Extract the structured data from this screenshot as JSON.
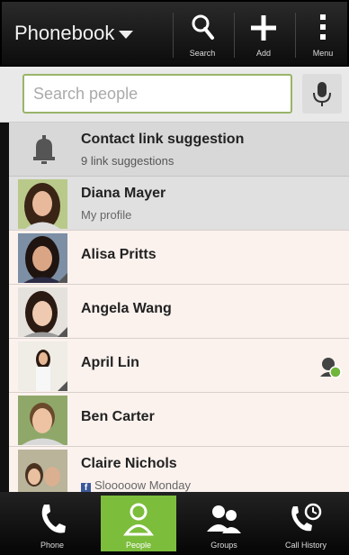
{
  "header": {
    "title": "Phonebook",
    "actions": [
      {
        "label": "Search",
        "icon": "search-icon"
      },
      {
        "label": "Add",
        "icon": "plus-icon"
      },
      {
        "label": "Menu",
        "icon": "overflow-menu-icon"
      }
    ]
  },
  "search": {
    "value": "",
    "placeholder": "Search people"
  },
  "suggestion": {
    "title": "Contact link suggestion",
    "subtitle": "9 link suggestions",
    "icon": "bell-icon"
  },
  "contacts": [
    {
      "name": "Diana Mayer",
      "subtitle": "My profile"
    },
    {
      "name": "Alisa Pritts",
      "subtitle": ""
    },
    {
      "name": "Angela Wang",
      "subtitle": ""
    },
    {
      "name": "April Lin",
      "subtitle": "",
      "status_icon": "online-presence-icon"
    },
    {
      "name": "Ben Carter",
      "subtitle": ""
    },
    {
      "name": "Claire Nichols",
      "subtitle": "Slooooow Monday",
      "subtitle_icon": "facebook-icon"
    }
  ],
  "tabs": [
    {
      "label": "Phone",
      "icon": "phone-icon",
      "active": false
    },
    {
      "label": "People",
      "icon": "person-icon",
      "active": true
    },
    {
      "label": "Groups",
      "icon": "groups-icon",
      "active": false
    },
    {
      "label": "Call History",
      "icon": "call-history-icon",
      "active": false
    }
  ],
  "colors": {
    "accent": "#7cbd3c",
    "search_border": "#9ab46a",
    "facebook": "#3b5998"
  }
}
